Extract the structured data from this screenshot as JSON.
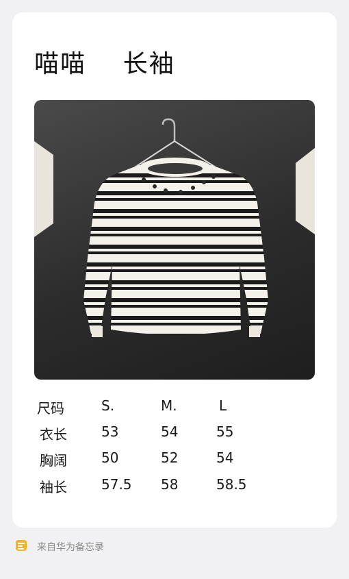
{
  "note": {
    "title": "喵喵    长袖",
    "image_alt": "striped sweater on hanger",
    "size_table": {
      "header": [
        "尺码",
        "S.",
        "M.",
        "L"
      ],
      "rows": [
        [
          "衣长",
          "53",
          "54",
          "55"
        ],
        [
          "胸阔",
          "50",
          "52",
          "54"
        ],
        [
          "袖长",
          "57.5",
          "58",
          "58.5"
        ]
      ]
    }
  },
  "footer": {
    "icon": "memo-app-icon",
    "text": "来自华为备忘录"
  },
  "colors": {
    "background": "#f1f1f3",
    "card": "#ffffff",
    "memo_icon": "#f0b429"
  }
}
